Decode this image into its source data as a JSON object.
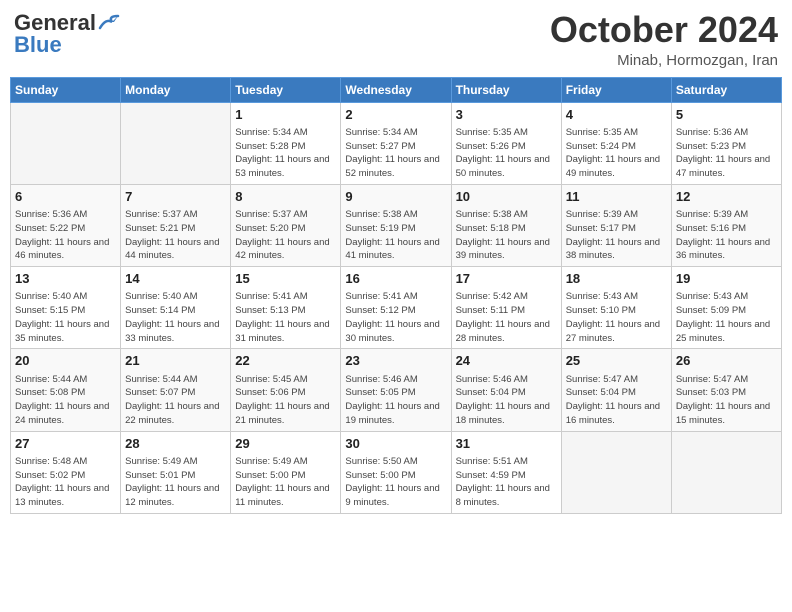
{
  "header": {
    "logo_general": "General",
    "logo_blue": "Blue",
    "month_title": "October 2024",
    "location": "Minab, Hormozgan, Iran"
  },
  "weekdays": [
    "Sunday",
    "Monday",
    "Tuesday",
    "Wednesday",
    "Thursday",
    "Friday",
    "Saturday"
  ],
  "weeks": [
    [
      {
        "day": "",
        "info": ""
      },
      {
        "day": "",
        "info": ""
      },
      {
        "day": "1",
        "info": "Sunrise: 5:34 AM\nSunset: 5:28 PM\nDaylight: 11 hours and 53 minutes."
      },
      {
        "day": "2",
        "info": "Sunrise: 5:34 AM\nSunset: 5:27 PM\nDaylight: 11 hours and 52 minutes."
      },
      {
        "day": "3",
        "info": "Sunrise: 5:35 AM\nSunset: 5:26 PM\nDaylight: 11 hours and 50 minutes."
      },
      {
        "day": "4",
        "info": "Sunrise: 5:35 AM\nSunset: 5:24 PM\nDaylight: 11 hours and 49 minutes."
      },
      {
        "day": "5",
        "info": "Sunrise: 5:36 AM\nSunset: 5:23 PM\nDaylight: 11 hours and 47 minutes."
      }
    ],
    [
      {
        "day": "6",
        "info": "Sunrise: 5:36 AM\nSunset: 5:22 PM\nDaylight: 11 hours and 46 minutes."
      },
      {
        "day": "7",
        "info": "Sunrise: 5:37 AM\nSunset: 5:21 PM\nDaylight: 11 hours and 44 minutes."
      },
      {
        "day": "8",
        "info": "Sunrise: 5:37 AM\nSunset: 5:20 PM\nDaylight: 11 hours and 42 minutes."
      },
      {
        "day": "9",
        "info": "Sunrise: 5:38 AM\nSunset: 5:19 PM\nDaylight: 11 hours and 41 minutes."
      },
      {
        "day": "10",
        "info": "Sunrise: 5:38 AM\nSunset: 5:18 PM\nDaylight: 11 hours and 39 minutes."
      },
      {
        "day": "11",
        "info": "Sunrise: 5:39 AM\nSunset: 5:17 PM\nDaylight: 11 hours and 38 minutes."
      },
      {
        "day": "12",
        "info": "Sunrise: 5:39 AM\nSunset: 5:16 PM\nDaylight: 11 hours and 36 minutes."
      }
    ],
    [
      {
        "day": "13",
        "info": "Sunrise: 5:40 AM\nSunset: 5:15 PM\nDaylight: 11 hours and 35 minutes."
      },
      {
        "day": "14",
        "info": "Sunrise: 5:40 AM\nSunset: 5:14 PM\nDaylight: 11 hours and 33 minutes."
      },
      {
        "day": "15",
        "info": "Sunrise: 5:41 AM\nSunset: 5:13 PM\nDaylight: 11 hours and 31 minutes."
      },
      {
        "day": "16",
        "info": "Sunrise: 5:41 AM\nSunset: 5:12 PM\nDaylight: 11 hours and 30 minutes."
      },
      {
        "day": "17",
        "info": "Sunrise: 5:42 AM\nSunset: 5:11 PM\nDaylight: 11 hours and 28 minutes."
      },
      {
        "day": "18",
        "info": "Sunrise: 5:43 AM\nSunset: 5:10 PM\nDaylight: 11 hours and 27 minutes."
      },
      {
        "day": "19",
        "info": "Sunrise: 5:43 AM\nSunset: 5:09 PM\nDaylight: 11 hours and 25 minutes."
      }
    ],
    [
      {
        "day": "20",
        "info": "Sunrise: 5:44 AM\nSunset: 5:08 PM\nDaylight: 11 hours and 24 minutes."
      },
      {
        "day": "21",
        "info": "Sunrise: 5:44 AM\nSunset: 5:07 PM\nDaylight: 11 hours and 22 minutes."
      },
      {
        "day": "22",
        "info": "Sunrise: 5:45 AM\nSunset: 5:06 PM\nDaylight: 11 hours and 21 minutes."
      },
      {
        "day": "23",
        "info": "Sunrise: 5:46 AM\nSunset: 5:05 PM\nDaylight: 11 hours and 19 minutes."
      },
      {
        "day": "24",
        "info": "Sunrise: 5:46 AM\nSunset: 5:04 PM\nDaylight: 11 hours and 18 minutes."
      },
      {
        "day": "25",
        "info": "Sunrise: 5:47 AM\nSunset: 5:04 PM\nDaylight: 11 hours and 16 minutes."
      },
      {
        "day": "26",
        "info": "Sunrise: 5:47 AM\nSunset: 5:03 PM\nDaylight: 11 hours and 15 minutes."
      }
    ],
    [
      {
        "day": "27",
        "info": "Sunrise: 5:48 AM\nSunset: 5:02 PM\nDaylight: 11 hours and 13 minutes."
      },
      {
        "day": "28",
        "info": "Sunrise: 5:49 AM\nSunset: 5:01 PM\nDaylight: 11 hours and 12 minutes."
      },
      {
        "day": "29",
        "info": "Sunrise: 5:49 AM\nSunset: 5:00 PM\nDaylight: 11 hours and 11 minutes."
      },
      {
        "day": "30",
        "info": "Sunrise: 5:50 AM\nSunset: 5:00 PM\nDaylight: 11 hours and 9 minutes."
      },
      {
        "day": "31",
        "info": "Sunrise: 5:51 AM\nSunset: 4:59 PM\nDaylight: 11 hours and 8 minutes."
      },
      {
        "day": "",
        "info": ""
      },
      {
        "day": "",
        "info": ""
      }
    ]
  ]
}
